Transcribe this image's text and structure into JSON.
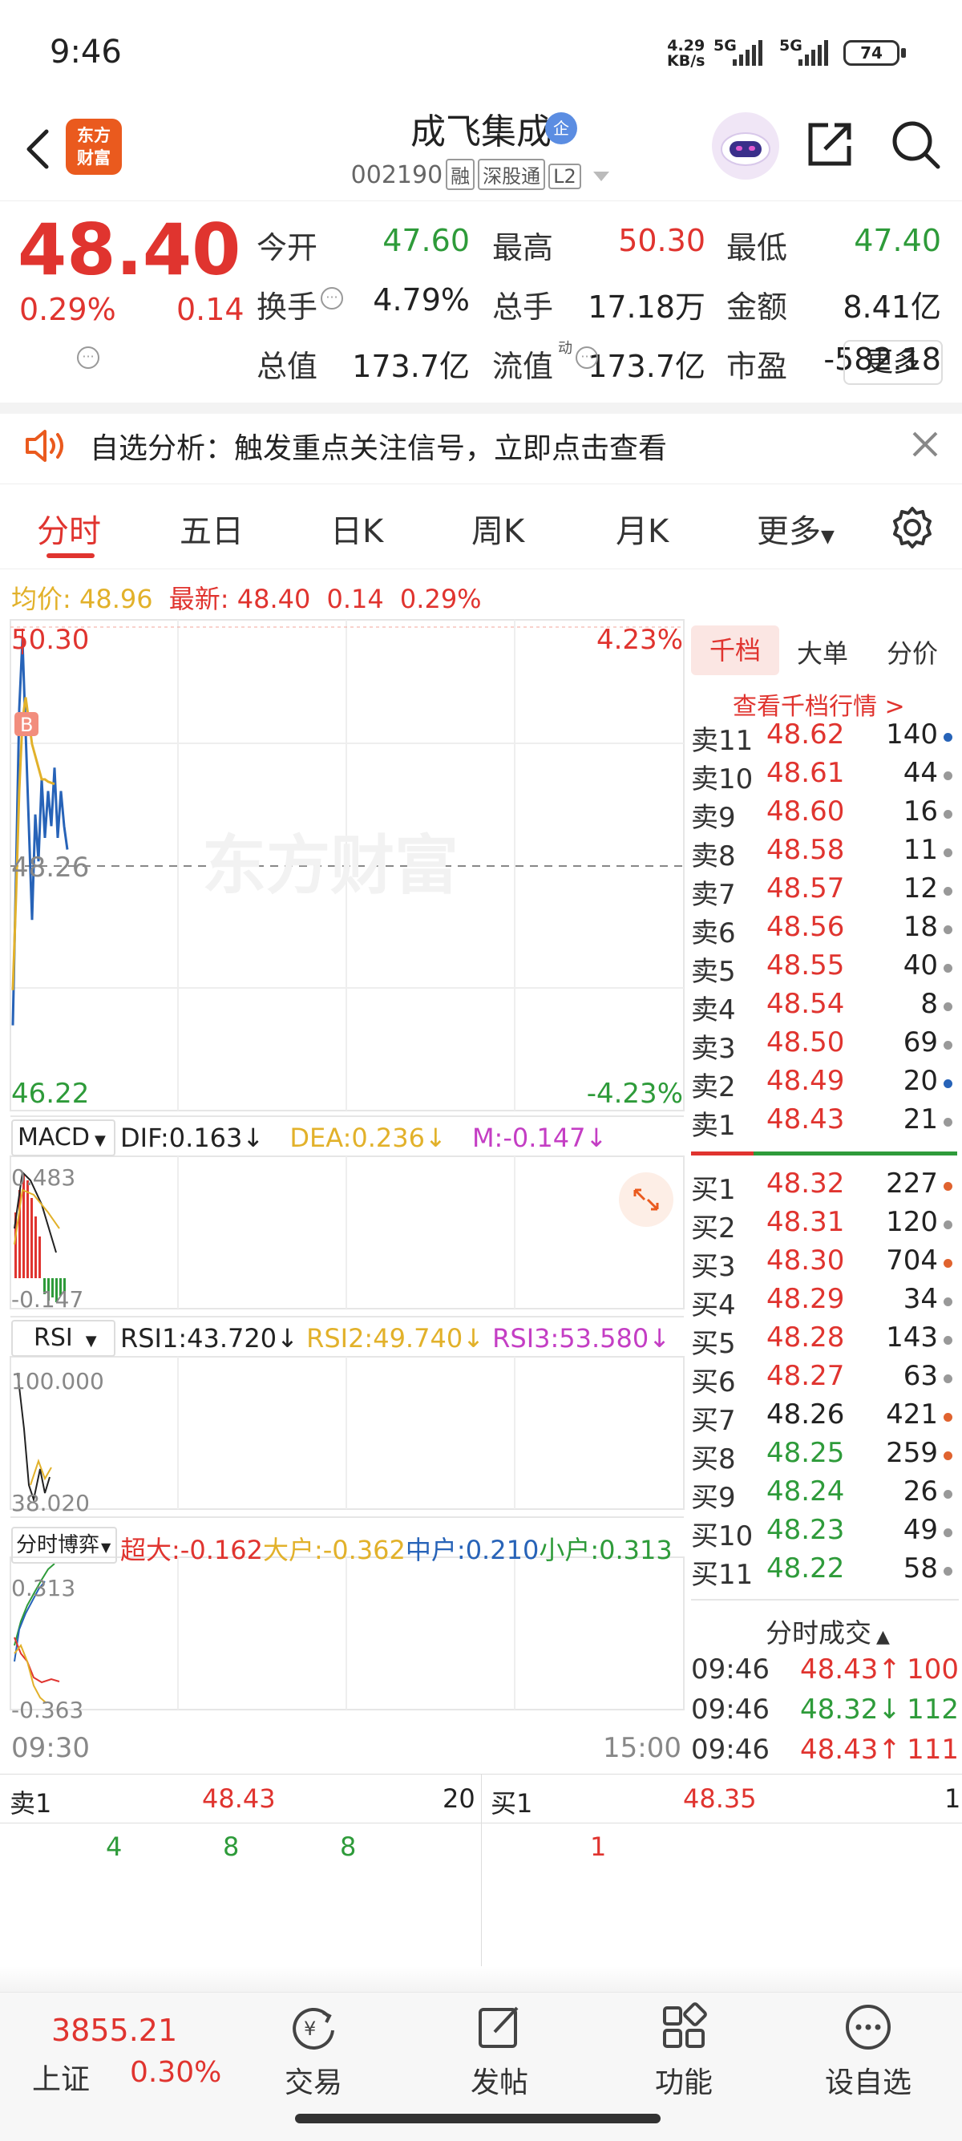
{
  "status_bar": {
    "time": "9:46",
    "net_speed_value": "4.29",
    "net_speed_unit": "KB/s",
    "signal1": "5G",
    "signal2": "5G",
    "battery": "74"
  },
  "header": {
    "brand_logo": "东方财富",
    "stock_name": "成飞集成",
    "enterprise_badge": "企",
    "stock_code": "002190",
    "tags": [
      "融",
      "深股通",
      "L2"
    ]
  },
  "quote": {
    "price": "48.40",
    "change_pct": "0.29%",
    "change_amt": "0.14",
    "fields": [
      {
        "label": "今开",
        "value": "47.60",
        "color": "#2e9b3a"
      },
      {
        "label": "最高",
        "value": "50.30",
        "color": "#e0342f"
      },
      {
        "label": "最低",
        "value": "47.40",
        "color": "#2e9b3a"
      },
      {
        "label": "换手",
        "value": "4.79%",
        "color": "#222222"
      },
      {
        "label": "总手",
        "value": "17.18万",
        "color": "#222222"
      },
      {
        "label": "金额",
        "value": "8.41亿",
        "color": "#222222"
      },
      {
        "label": "总值",
        "value": "173.7亿",
        "color": "#222222"
      },
      {
        "label": "流值",
        "value": "173.7亿",
        "color": "#222222"
      },
      {
        "label": "市盈",
        "value": "-582.18",
        "color": "#222222"
      }
    ],
    "pe_superscript": "动",
    "more_label": "更多"
  },
  "banner": {
    "text": "自选分析：触发重点关注信号，立即点击查看"
  },
  "tabs": [
    "分时",
    "五日",
    "日K",
    "周K",
    "月K",
    "更多"
  ],
  "avg_row": {
    "avg_label": "均价:",
    "avg_value": "48.96",
    "latest_label": "最新:",
    "latest_value": "48.40",
    "change": "0.14",
    "pct": "0.29%"
  },
  "chart": {
    "watermark": "东方财富",
    "y_high": "50.30",
    "y_mid": "48.26",
    "y_low": "46.22",
    "pct_high": "4.23%",
    "pct_low": "-4.23%",
    "buy_marker": "B",
    "time_start": "09:30",
    "time_end": "15:00"
  },
  "chart_data": {
    "type": "line",
    "ylim": [
      46.22,
      50.3
    ],
    "reference": 48.26,
    "series": [
      {
        "values": [
          46.9,
          48.2,
          49.6,
          50.2,
          49.4,
          48.6,
          47.8,
          48.7,
          48.3,
          49.0,
          48.5,
          48.9,
          48.6,
          49.1,
          48.5,
          48.9,
          48.6,
          48.4
        ]
      },
      {
        "values": [
          47.2,
          48.0,
          48.9,
          49.5,
          49.7,
          49.5,
          49.3,
          49.2,
          49.1,
          49.0,
          49.0,
          48.98,
          48.97,
          48.96
        ]
      }
    ]
  },
  "indicators": {
    "macd": {
      "selector": "MACD",
      "dif": "DIF:0.163↓",
      "dea": "DEA:0.236↓",
      "m": "M:-0.147↓",
      "top": "0.483",
      "bottom": "-0.147"
    },
    "rsi": {
      "selector": "RSI",
      "rsi1": "RSI1:43.720↓",
      "rsi2": "RSI2:49.740↓",
      "rsi3": "RSI3:53.580↓",
      "top": "100.000",
      "bottom": "38.020"
    },
    "flow": {
      "selector": "分时博弈",
      "super": "超大:-0.162",
      "large": "大户:-0.362",
      "medium": "中户:0.210",
      "small": "小户:0.313",
      "top": "0.313",
      "bottom": "-0.363"
    }
  },
  "order_book": {
    "tabs": [
      "千档",
      "大单",
      "分价"
    ],
    "link": "查看千档行情 >",
    "asks": [
      {
        "label": "卖11",
        "price": "48.62",
        "vol": "140",
        "dot": "#2763b8"
      },
      {
        "label": "卖10",
        "price": "48.61",
        "vol": "44",
        "dot": "#999999"
      },
      {
        "label": "卖9",
        "price": "48.60",
        "vol": "16",
        "dot": "#999999"
      },
      {
        "label": "卖8",
        "price": "48.58",
        "vol": "11",
        "dot": "#999999"
      },
      {
        "label": "卖7",
        "price": "48.57",
        "vol": "12",
        "dot": "#999999"
      },
      {
        "label": "卖6",
        "price": "48.56",
        "vol": "18",
        "dot": "#999999"
      },
      {
        "label": "卖5",
        "price": "48.55",
        "vol": "40",
        "dot": "#999999"
      },
      {
        "label": "卖4",
        "price": "48.54",
        "vol": "8",
        "dot": "#999999"
      },
      {
        "label": "卖3",
        "price": "48.50",
        "vol": "69",
        "dot": "#999999"
      },
      {
        "label": "卖2",
        "price": "48.49",
        "vol": "20",
        "dot": "#2763b8"
      },
      {
        "label": "卖1",
        "price": "48.43",
        "vol": "21",
        "dot": "#999999"
      }
    ],
    "bids": [
      {
        "label": "买1",
        "price": "48.32",
        "vol": "227",
        "dot": "#e0632f",
        "color": "#e0342f"
      },
      {
        "label": "买2",
        "price": "48.31",
        "vol": "120",
        "dot": "#999999",
        "color": "#e0342f"
      },
      {
        "label": "买3",
        "price": "48.30",
        "vol": "704",
        "dot": "#e0632f",
        "color": "#e0342f"
      },
      {
        "label": "买4",
        "price": "48.29",
        "vol": "34",
        "dot": "#999999",
        "color": "#e0342f"
      },
      {
        "label": "买5",
        "price": "48.28",
        "vol": "143",
        "dot": "#999999",
        "color": "#e0342f"
      },
      {
        "label": "买6",
        "price": "48.27",
        "vol": "63",
        "dot": "#999999",
        "color": "#e0342f"
      },
      {
        "label": "买7",
        "price": "48.26",
        "vol": "421",
        "dot": "#e0632f",
        "color": "#222222"
      },
      {
        "label": "买8",
        "price": "48.25",
        "vol": "259",
        "dot": "#e0632f",
        "color": "#2e9b3a"
      },
      {
        "label": "买9",
        "price": "48.24",
        "vol": "26",
        "dot": "#999999",
        "color": "#2e9b3a"
      },
      {
        "label": "买10",
        "price": "48.23",
        "vol": "49",
        "dot": "#999999",
        "color": "#2e9b3a"
      },
      {
        "label": "买11",
        "price": "48.22",
        "vol": "58",
        "dot": "#999999",
        "color": "#2e9b3a"
      }
    ],
    "trades_title": "分时成交",
    "trades": [
      {
        "time": "09:46",
        "price": "48.43↑",
        "vol": "100",
        "color": "#e0342f"
      },
      {
        "time": "09:46",
        "price": "48.32↓",
        "vol": "112",
        "color": "#2e9b3a"
      },
      {
        "time": "09:46",
        "price": "48.43↑",
        "vol": "111",
        "color": "#e0342f"
      }
    ]
  },
  "level1": {
    "ask_label": "卖1",
    "ask_price": "48.43",
    "ask_vol": "20",
    "bid_label": "买1",
    "bid_price": "48.35",
    "bid_vol": "1",
    "ask_queue": [
      "4",
      "8",
      "8"
    ],
    "bid_queue": [
      "1"
    ]
  },
  "bottom_nav": {
    "index_value": "3855.21",
    "index_name": "上证",
    "index_pct": "0.30%",
    "items": [
      "交易",
      "发帖",
      "功能",
      "设自选"
    ]
  }
}
